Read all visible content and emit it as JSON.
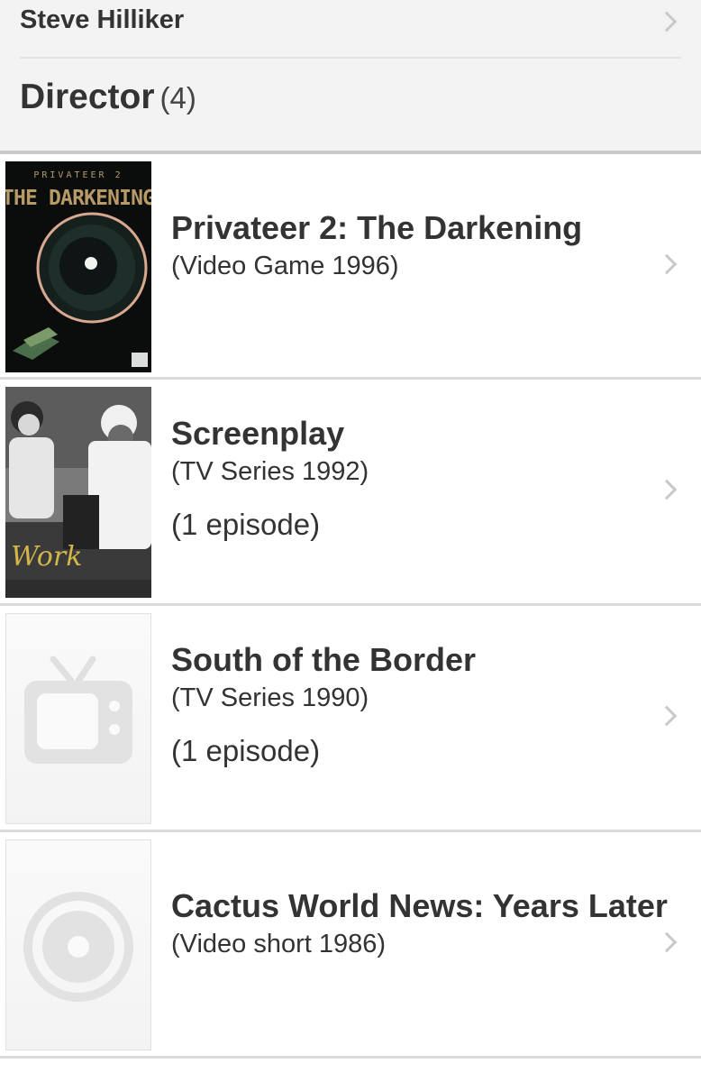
{
  "previous_item": {
    "name": "Steve Hilliker"
  },
  "section": {
    "title": "Director",
    "count": "(4)"
  },
  "items": [
    {
      "title": "Privateer 2: The Darkening",
      "subtitle": "(Video Game 1996)",
      "episodes": "",
      "poster": {
        "top_text": "PRIVATEER 2",
        "main_text": "THE DARKENING"
      }
    },
    {
      "title": "Screenplay",
      "subtitle": "(TV Series 1992)",
      "episodes": "(1 episode)",
      "poster": {
        "script_text": "Work"
      }
    },
    {
      "title": "South of the Border",
      "subtitle": "(TV Series 1990)",
      "episodes": "(1 episode)",
      "poster": {
        "icon": "tv-placeholder-icon"
      }
    },
    {
      "title": "Cactus World News: Years Later",
      "subtitle": "(Video short 1986)",
      "episodes": "",
      "poster": {
        "icon": "disc-placeholder-icon"
      }
    }
  ],
  "colors": {
    "header_bg": "#f3f3f3",
    "divider": "#dcdcdc",
    "chevron": "#c9c9c9",
    "placeholder_icon": "#e2e2e2"
  }
}
